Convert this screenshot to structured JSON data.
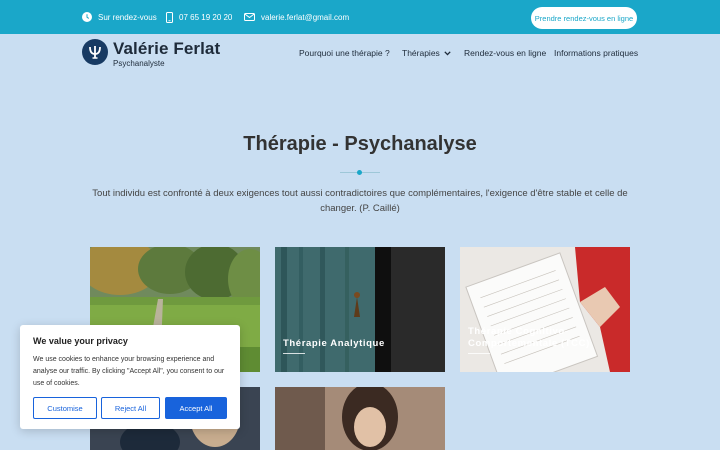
{
  "topbar": {
    "appointment_info": "Sur rendez-vous",
    "phone": "07 65 19 20 20",
    "email": "valerie.ferlat@gmail.com",
    "cta": "Prendre rendez-vous en ligne"
  },
  "brand": {
    "name": "Valérie Ferlat",
    "subtitle": "Psychanalyste",
    "logo_icon": "psi-icon"
  },
  "nav": {
    "items": [
      {
        "label": "Pourquoi une thérapie ?"
      },
      {
        "label": "Thérapies",
        "has_dropdown": true
      },
      {
        "label": "Rendez-vous en ligne"
      },
      {
        "label": "Informations pratiques"
      }
    ]
  },
  "main": {
    "title": "Thérapie - Psychanalyse",
    "intro": "Tout individu est confronté à deux exigences tout aussi contradictoires que complémentaires, l'exigence d'être stable et celle de changer. (P. Caillé)",
    "cards": [
      {
        "label": ""
      },
      {
        "label": "Thérapie Analytique"
      },
      {
        "label": "Thérapie Cognitivo-Comportementale (TCC)"
      },
      {
        "label": ""
      },
      {
        "label": ""
      }
    ]
  },
  "cookie": {
    "title": "We value your privacy",
    "text": "We use cookies to enhance your browsing experience and analyse our traffic. By clicking \"Accept All\", you consent to our use of cookies.",
    "customise": "Customise",
    "reject": "Reject All",
    "accept": "Accept All"
  },
  "colors": {
    "topbar": "#1aa7c9",
    "page_background": "#c9def2",
    "brand_navy": "#173a63",
    "cookie_button_blue": "#1863dc"
  }
}
